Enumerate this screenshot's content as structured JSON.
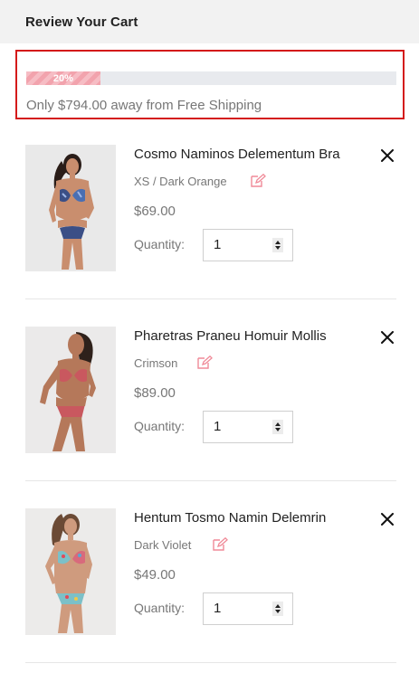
{
  "header": {
    "title": "Review Your Cart"
  },
  "shipping": {
    "progress_label": "20%",
    "progress_value": 0.2,
    "message": "Only $794.00 away from Free Shipping",
    "border_color": "#d41a1a",
    "bar_color": "#f2a3ad"
  },
  "qty_label": "Quantity:",
  "items": [
    {
      "name": "Cosmo Naminos Delementum Bra",
      "variant": "XS / Dark Orange",
      "price": "$69.00",
      "quantity": "1"
    },
    {
      "name": "Pharetras Praneu Homuir Mollis",
      "variant": "Crimson",
      "price": "$89.00",
      "quantity": "1"
    },
    {
      "name": "Hentum Tosmo Namin Delemrin",
      "variant": "Dark Violet",
      "price": "$49.00",
      "quantity": "1"
    }
  ],
  "icons": {
    "remove": "close-icon",
    "edit": "edit-icon",
    "spinner": "spinner-arrows-icon"
  },
  "colors": {
    "accent_pink": "#f08a98"
  }
}
